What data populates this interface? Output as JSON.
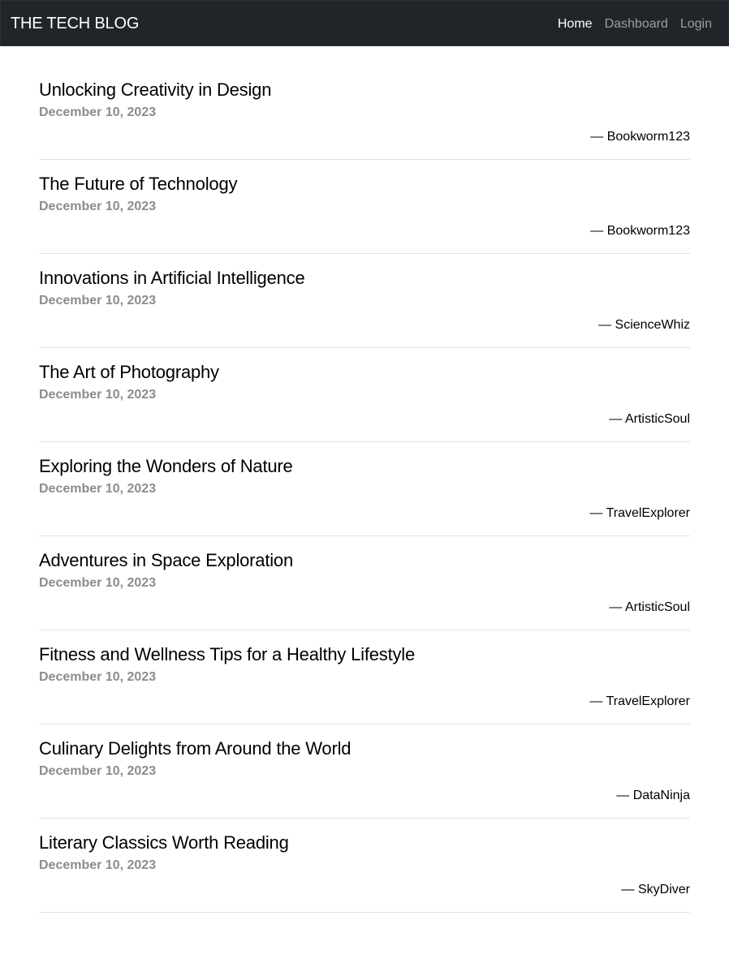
{
  "navbar": {
    "brand": "THE TECH BLOG",
    "links": [
      {
        "label": "Home",
        "active": true
      },
      {
        "label": "Dashboard",
        "active": false
      },
      {
        "label": "Login",
        "active": false
      }
    ]
  },
  "posts": [
    {
      "title": "Unlocking Creativity in Design",
      "date": "December 10, 2023",
      "author": "— Bookworm123"
    },
    {
      "title": "The Future of Technology",
      "date": "December 10, 2023",
      "author": "— Bookworm123"
    },
    {
      "title": "Innovations in Artificial Intelligence",
      "date": "December 10, 2023",
      "author": "— ScienceWhiz"
    },
    {
      "title": "The Art of Photography",
      "date": "December 10, 2023",
      "author": "— ArtisticSoul"
    },
    {
      "title": "Exploring the Wonders of Nature",
      "date": "December 10, 2023",
      "author": "— TravelExplorer"
    },
    {
      "title": "Adventures in Space Exploration",
      "date": "December 10, 2023",
      "author": "— ArtisticSoul"
    },
    {
      "title": "Fitness and Wellness Tips for a Healthy Lifestyle",
      "date": "December 10, 2023",
      "author": "— TravelExplorer"
    },
    {
      "title": "Culinary Delights from Around the World",
      "date": "December 10, 2023",
      "author": "— DataNinja"
    },
    {
      "title": "Literary Classics Worth Reading",
      "date": "December 10, 2023",
      "author": "— SkyDiver"
    }
  ],
  "colors": {
    "navbar_bg": "#212529",
    "nav_active": "#ffffff",
    "nav_inactive": "#9a9c9e",
    "date": "#8c8c8c",
    "divider": "#dee2e6"
  }
}
